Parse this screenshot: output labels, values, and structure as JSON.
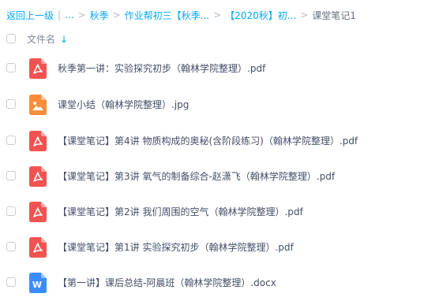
{
  "breadcrumb": {
    "back": "返回上一级",
    "ellipsis": "...",
    "items": [
      "秋季",
      "作业帮初三【秋季...",
      "【2020秋】初..."
    ],
    "current": "课堂笔记1"
  },
  "header": {
    "column_label": "文件名"
  },
  "files": [
    {
      "name": "秋季第一讲：实验探究初步（翰林学院整理）.pdf",
      "icon": "pdf-icon"
    },
    {
      "name": "课堂小结（翰林学院整理）.jpg",
      "icon": "image-icon"
    },
    {
      "name": "【课堂笔记】第4讲 物质构成的奥秘(含阶段练习)（翰林学院整理）.pdf",
      "icon": "pdf-icon"
    },
    {
      "name": "【课堂笔记】第3讲 氧气的制备综合-赵潇飞（翰林学院整理）.pdf",
      "icon": "pdf-icon"
    },
    {
      "name": "【课堂笔记】第2讲 我们周围的空气（翰林学院整理）.pdf",
      "icon": "pdf-icon"
    },
    {
      "name": "【课堂笔记】第1讲 实验探究初步（翰林学院整理）.pdf",
      "icon": "pdf-icon"
    },
    {
      "name": "【第一讲】课后总结-阿晨班（翰林学院整理）.docx",
      "icon": "word-icon"
    }
  ],
  "colors": {
    "accent": "#06a7ff",
    "pdf": "#f25350",
    "image": "#f98c3b",
    "word": "#3b8cff"
  },
  "icon_letters": {
    "word": "W"
  }
}
